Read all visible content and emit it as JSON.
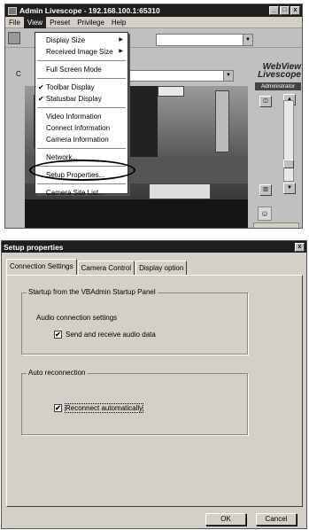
{
  "admin_window": {
    "title": "Admin Livescope - 192.168.100.1:65310",
    "menu": [
      "File",
      "View",
      "Preset",
      "Privilege",
      "Help"
    ],
    "active_menu": "View",
    "camera_label": "C",
    "logo_line1": "WebView",
    "logo_line2": "Livescope",
    "logo_badge": "Administrator",
    "view_menu": {
      "display_size": "Display Size",
      "received_image_size": "Received Image Size",
      "full_screen_mode": "Full Screen Mode",
      "toolbar_display": "Toolbar Display",
      "statusbar_display": "Statusbar Display",
      "video_information": "Video Information",
      "connect_information": "Connect Information",
      "camera_information": "Camera Information",
      "network": "Network...",
      "setup_properties": "Setup Properties...",
      "camera_site_list": "Camera Site List...",
      "check_mark": "✔",
      "submenu_arrow": "▶"
    }
  },
  "setup_window": {
    "title": "Setup properties",
    "tabs": [
      "Connection Settings",
      "Camera Control",
      "Display option"
    ],
    "selected_tab": "Connection Settings",
    "startup_group": {
      "legend": "Startup from the VBAdmin Startup Panel",
      "audio_label": "Audio connection settings",
      "audio_checkbox": "Send and receive audio data",
      "audio_checked": true
    },
    "reconnect_group": {
      "legend": "Auto reconnection",
      "reconnect_checkbox": "Reconnect automatically",
      "reconnect_checked": true
    },
    "ok_label": "OK",
    "cancel_label": "Cancel"
  },
  "icons": {
    "minimize": "_",
    "maximize": "□",
    "close": "x",
    "dropdown_arrow": "▼",
    "check": "✔"
  }
}
